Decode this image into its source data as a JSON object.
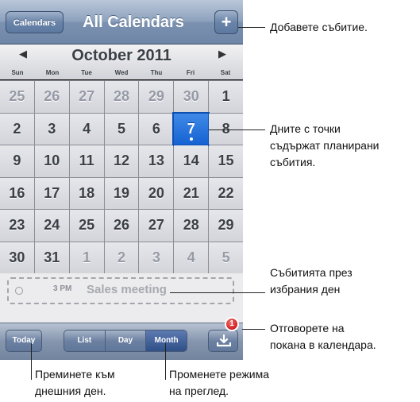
{
  "navbar": {
    "calendars_label": "Calendars",
    "title": "All Calendars",
    "add_label": "+"
  },
  "month_header": {
    "prev": "◀",
    "next": "▶",
    "month": "October 2011",
    "weekdays": [
      "Sun",
      "Mon",
      "Tue",
      "Wed",
      "Thu",
      "Fri",
      "Sat"
    ]
  },
  "days": [
    {
      "n": "25",
      "muted": true
    },
    {
      "n": "26",
      "muted": true
    },
    {
      "n": "27",
      "muted": true
    },
    {
      "n": "28",
      "muted": true
    },
    {
      "n": "29",
      "muted": true
    },
    {
      "n": "30",
      "muted": true
    },
    {
      "n": "1"
    },
    {
      "n": "2"
    },
    {
      "n": "3"
    },
    {
      "n": "4"
    },
    {
      "n": "5"
    },
    {
      "n": "6"
    },
    {
      "n": "7",
      "selected": true,
      "dot": true
    },
    {
      "n": "8"
    },
    {
      "n": "9"
    },
    {
      "n": "10"
    },
    {
      "n": "11"
    },
    {
      "n": "12"
    },
    {
      "n": "13"
    },
    {
      "n": "14"
    },
    {
      "n": "15"
    },
    {
      "n": "16"
    },
    {
      "n": "17"
    },
    {
      "n": "18"
    },
    {
      "n": "19"
    },
    {
      "n": "20"
    },
    {
      "n": "21"
    },
    {
      "n": "22"
    },
    {
      "n": "23"
    },
    {
      "n": "24"
    },
    {
      "n": "25"
    },
    {
      "n": "26"
    },
    {
      "n": "27"
    },
    {
      "n": "28"
    },
    {
      "n": "29"
    },
    {
      "n": "30"
    },
    {
      "n": "31"
    },
    {
      "n": "1",
      "muted": true
    },
    {
      "n": "2",
      "muted": true
    },
    {
      "n": "3",
      "muted": true
    },
    {
      "n": "4",
      "muted": true
    },
    {
      "n": "5",
      "muted": true
    }
  ],
  "event": {
    "time": "3 PM",
    "title": "Sales meeting"
  },
  "toolbar": {
    "today": "Today",
    "views": [
      "List",
      "Day",
      "Month"
    ],
    "active_view": "Month",
    "badge": "1"
  },
  "callouts": {
    "add_event": "Добавете събитие.",
    "dots_1": "Дните с точки",
    "dots_2": "съдържат планирани",
    "dots_3": "събития.",
    "events_1": "Събитията през",
    "events_2": "избрания ден",
    "invite_1": "Отговорете на",
    "invite_2": "покана в календара.",
    "today_1": "Преминете към",
    "today_2": "днешния ден.",
    "view_1": "Променете режима",
    "view_2": "на преглед."
  },
  "colors": {
    "accent": "#1a68d6",
    "badge": "#d01f1f"
  }
}
